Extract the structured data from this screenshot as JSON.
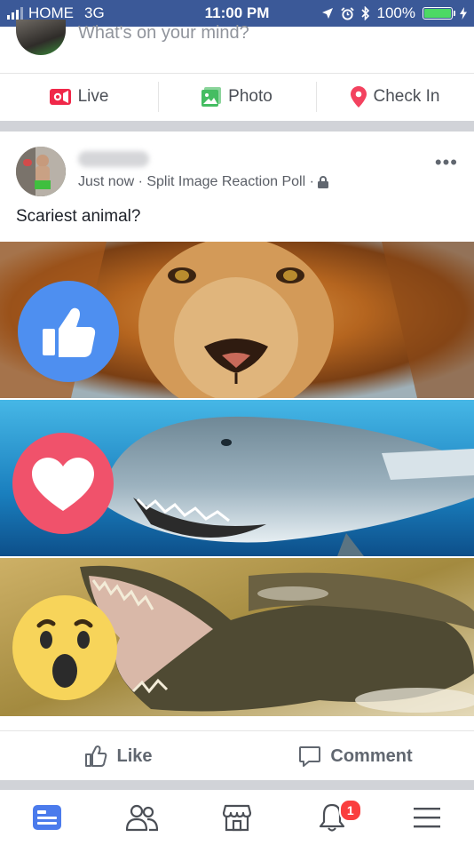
{
  "status_bar": {
    "carrier": "HOME",
    "network": "3G",
    "time": "11:00 PM",
    "battery": "100%",
    "signal_bars": 3
  },
  "composer": {
    "prompt": "What's on your mind?"
  },
  "composer_actions": [
    {
      "label": "Live",
      "icon": "live-video-icon",
      "color": "#f02849"
    },
    {
      "label": "Photo",
      "icon": "photo-icon",
      "color": "#45bd62"
    },
    {
      "label": "Check In",
      "icon": "location-pin-icon",
      "color": "#f3425f"
    }
  ],
  "post": {
    "meta": "Just now · Split Image Reaction Poll ·",
    "privacy_icon": "lock-icon",
    "caption": "Scariest animal?",
    "panels": [
      {
        "animal": "lion",
        "reaction": "like",
        "reaction_color": "#4e8ff0"
      },
      {
        "animal": "shark",
        "reaction": "love",
        "reaction_color": "#f0526b"
      },
      {
        "animal": "crocodile",
        "reaction": "wow",
        "reaction_color": "#f7d45a"
      }
    ],
    "actions": [
      {
        "label": "Like",
        "icon": "thumbs-up-icon"
      },
      {
        "label": "Comment",
        "icon": "comment-icon"
      }
    ]
  },
  "tabbar": {
    "items": [
      "news-feed-icon",
      "friends-icon",
      "marketplace-icon",
      "notifications-icon",
      "menu-icon"
    ],
    "active": "news-feed-icon",
    "notification_count": "1",
    "active_color": "#4b7bec"
  }
}
